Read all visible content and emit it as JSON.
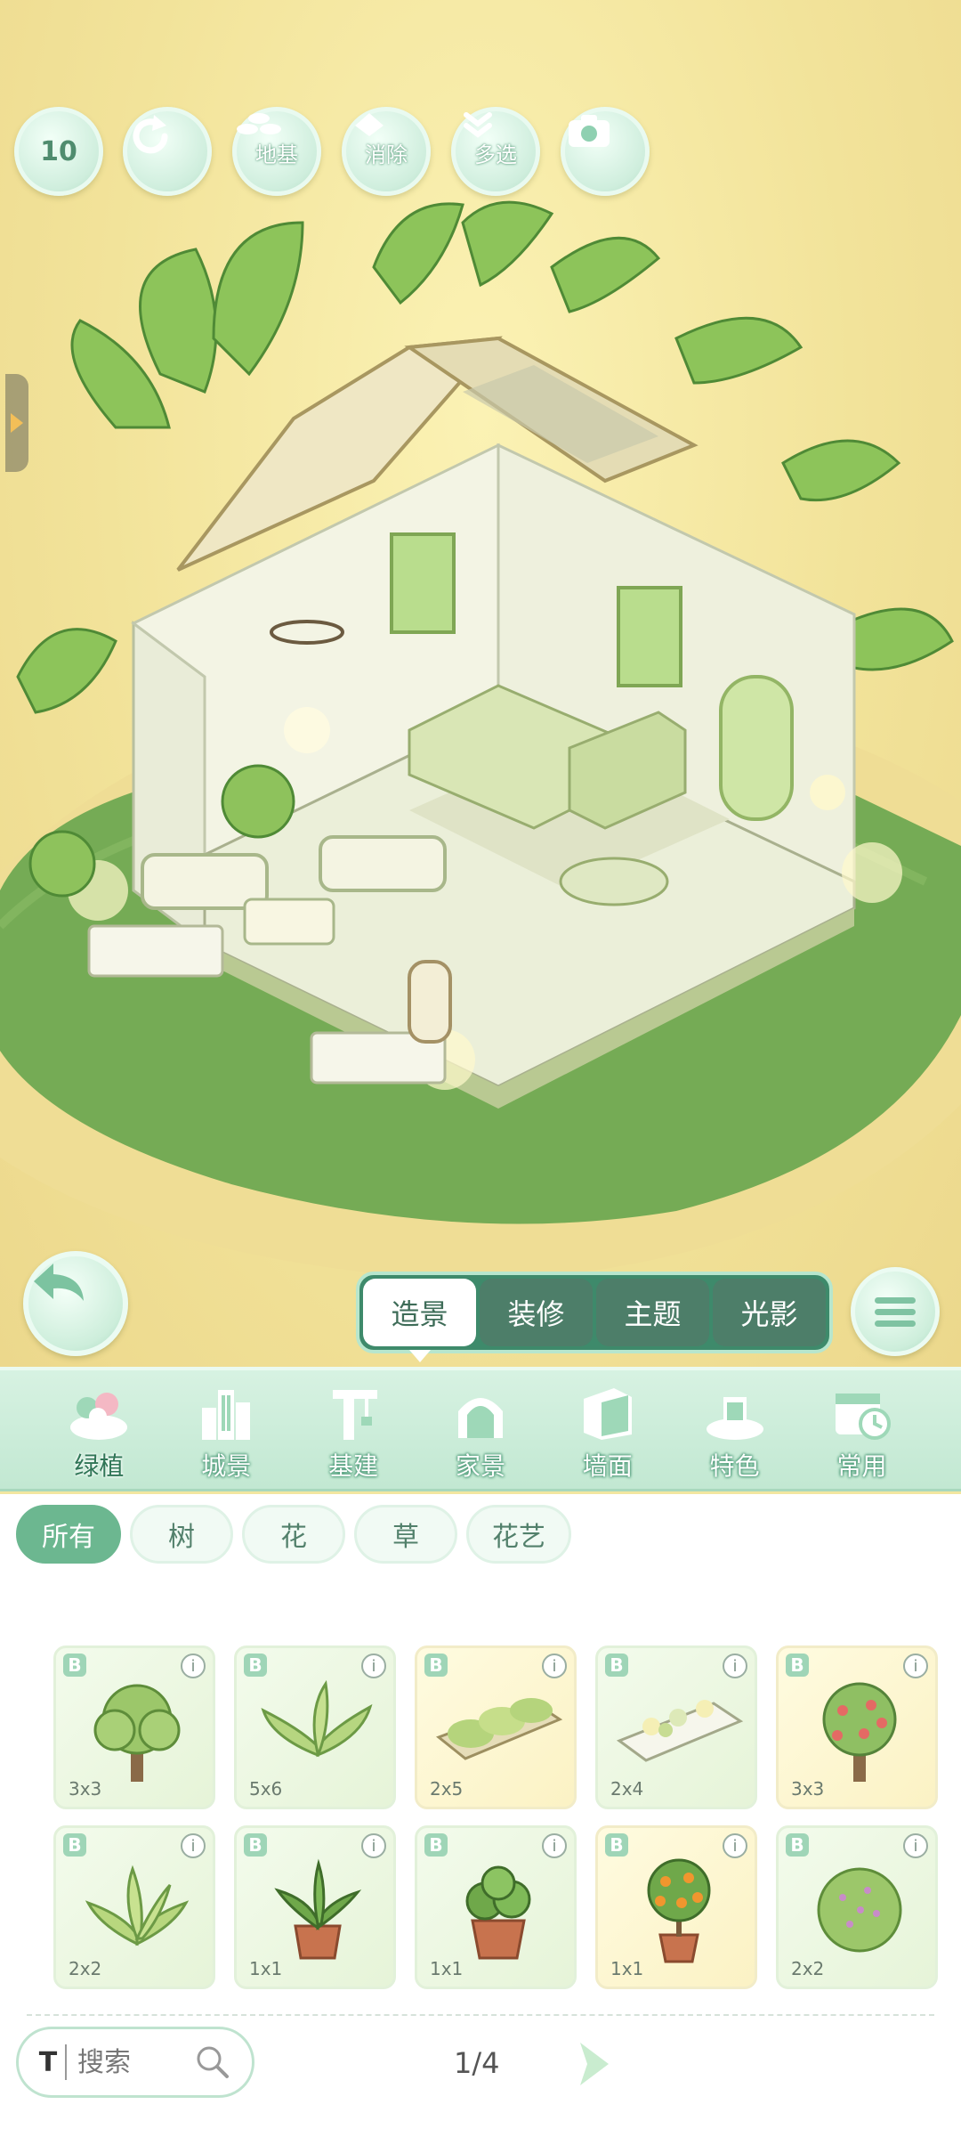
{
  "toolbar": {
    "undo_count": "10",
    "redo": "",
    "foundation_label": "地基",
    "erase_label": "消除",
    "multiselect_label": "多选"
  },
  "mode_tabs": [
    {
      "label": "造景",
      "active": true
    },
    {
      "label": "装修",
      "active": false
    },
    {
      "label": "主题",
      "active": false
    },
    {
      "label": "光影",
      "active": false
    }
  ],
  "categories": [
    {
      "label": "绿植",
      "icon": "plant-icon",
      "active": true
    },
    {
      "label": "城景",
      "icon": "city-icon",
      "active": false
    },
    {
      "label": "基建",
      "icon": "crane-icon",
      "active": false
    },
    {
      "label": "家景",
      "icon": "home-scene-icon",
      "active": false
    },
    {
      "label": "墙面",
      "icon": "wall-icon",
      "active": false
    },
    {
      "label": "特色",
      "icon": "special-icon",
      "active": false
    },
    {
      "label": "常用",
      "icon": "recent-icon",
      "active": false
    }
  ],
  "filters": [
    {
      "label": "所有",
      "active": true
    },
    {
      "label": "树",
      "active": false
    },
    {
      "label": "花",
      "active": false
    },
    {
      "label": "草",
      "active": false
    },
    {
      "label": "花艺",
      "active": false
    }
  ],
  "items": [
    {
      "badge": "B",
      "size": "3x3",
      "icon": "green-tree-icon"
    },
    {
      "badge": "B",
      "size": "5x6",
      "icon": "fern-plant-icon"
    },
    {
      "badge": "B",
      "size": "2x5",
      "icon": "hedge-planter-icon"
    },
    {
      "badge": "B",
      "size": "2x4",
      "icon": "flower-fence-icon"
    },
    {
      "badge": "B",
      "size": "3x3",
      "icon": "apple-tree-icon"
    },
    {
      "badge": "B",
      "size": "2x2",
      "icon": "palm-shrub-icon"
    },
    {
      "badge": "B",
      "size": "1x1",
      "icon": "potted-dracaena-icon"
    },
    {
      "badge": "B",
      "size": "1x1",
      "icon": "potted-leafy-plant-icon"
    },
    {
      "badge": "B",
      "size": "1x1",
      "icon": "potted-orange-tree-icon"
    },
    {
      "badge": "B",
      "size": "2x2",
      "icon": "flowering-bush-icon"
    }
  ],
  "search": {
    "placeholder": "搜索"
  },
  "pager": {
    "text": "1/4"
  }
}
